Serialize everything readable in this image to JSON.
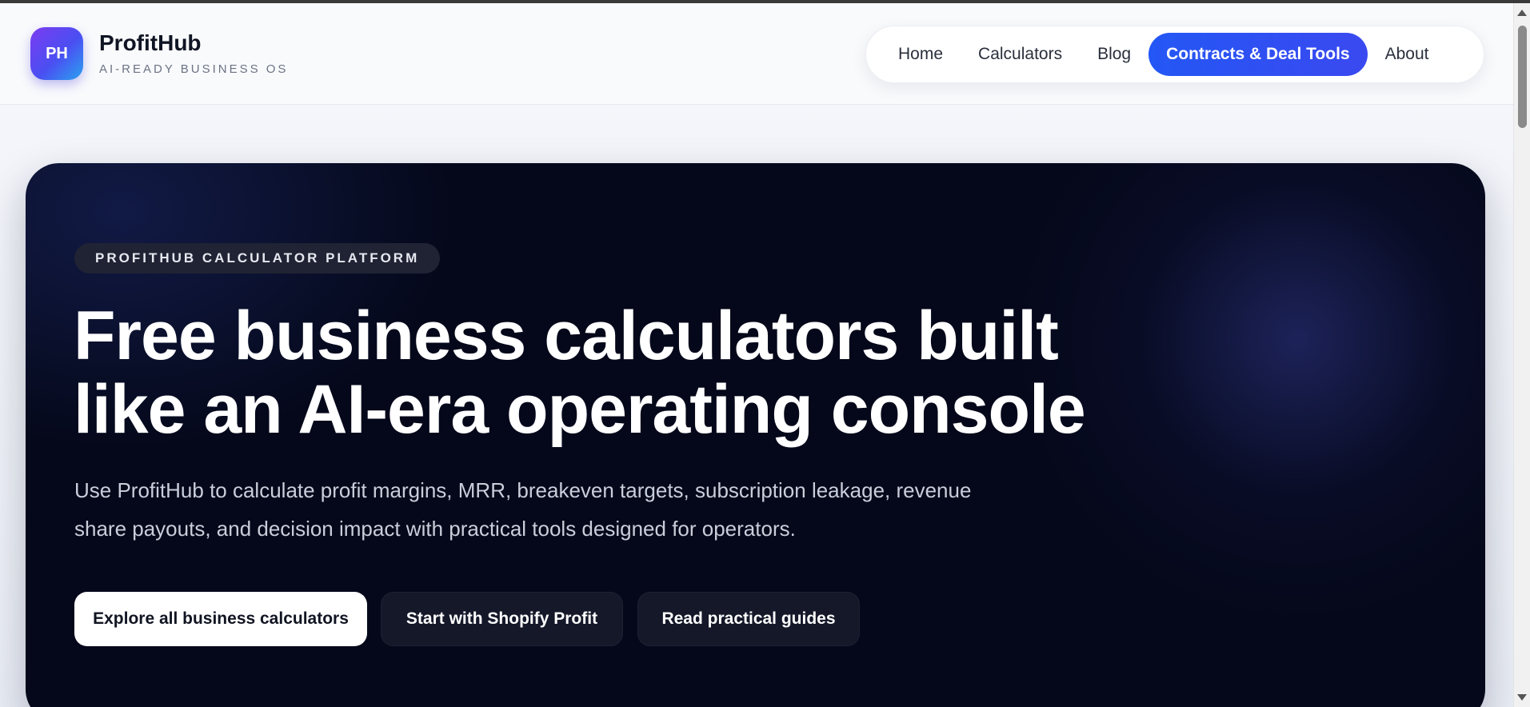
{
  "header": {
    "logo_text": "PH",
    "brand_name": "ProfitHub",
    "brand_tagline": "AI-READY BUSINESS OS"
  },
  "nav": {
    "items": [
      {
        "label": "Home",
        "active": false
      },
      {
        "label": "Calculators",
        "active": false
      },
      {
        "label": "Blog",
        "active": false
      },
      {
        "label": "Contracts & Deal Tools",
        "active": true
      },
      {
        "label": "About",
        "active": false
      }
    ]
  },
  "hero": {
    "eyebrow": "PROFITHUB CALCULATOR PLATFORM",
    "title_line1": "Free business calculators built",
    "title_line2": "like an AI-era operating console",
    "description_line1": "Use ProfitHub to calculate profit margins, MRR, breakeven targets, subscription leakage, revenue",
    "description_line2": "share payouts, and decision impact with practical tools designed for operators.",
    "buttons": {
      "primary": "Explore all business calculators",
      "shopify": "Start with Shopify Profit",
      "guides": "Read practical guides"
    }
  },
  "colors": {
    "accent": "#2457f5",
    "hero_bg": "#05081a",
    "page_bg": "#f3f5fa"
  }
}
